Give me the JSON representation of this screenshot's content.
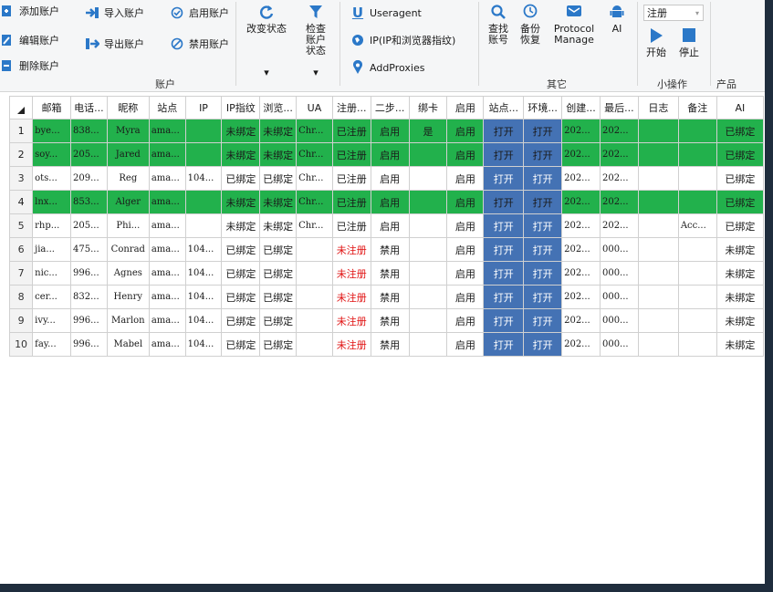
{
  "ribbon": {
    "account_group": {
      "add_account": "添加账户",
      "edit_account": "编辑账户",
      "delete_account": "删除账户",
      "import_account": "导入账户",
      "export_account": "导出账户",
      "enable_account": "启用账户",
      "disable_account": "禁用账户",
      "group_label": "账户"
    },
    "change_status": "改变状态",
    "check_status": "检查账户状态",
    "useragent": "Useragent",
    "ip_fingerprint": "IP(IP和浏览器指纹)",
    "add_proxies": "AddProxies",
    "find_account": "查找账号",
    "backup_restore": "备份恢复",
    "protocol_manage": "Protocol Manage",
    "ai": "AI",
    "other_label": "其它",
    "register_combo": "注册",
    "start": "开始",
    "stop": "停止",
    "small_ops_label": "小操作",
    "product_label": "产品"
  },
  "table": {
    "headers": [
      "",
      "邮箱",
      "电话...",
      "昵称",
      "站点",
      "IP",
      "IP指纹",
      "浏览...",
      "UA",
      "注册...",
      "二步...",
      "绑卡",
      "启用",
      "站点...",
      "环境...",
      "创建...",
      "最后...",
      "日志",
      "备注",
      "AI"
    ],
    "rows": [
      {
        "n": "1",
        "email": "bye...",
        "phone": "838...",
        "nick": "Myra",
        "site": "ama...",
        "ip": "",
        "ipfp": "未绑定",
        "browser": "未绑定",
        "ua": "Chr...",
        "reg": "已注册",
        "twostep": "启用",
        "card": "是",
        "enabled": "启用",
        "siteopen": "打开",
        "env": "打开",
        "created": "202...",
        "last": "202...",
        "log": "",
        "note": "",
        "ai": "已绑定",
        "green": true
      },
      {
        "n": "2",
        "email": "soy...",
        "phone": "205...",
        "nick": "Jared",
        "site": "ama...",
        "ip": "",
        "ipfp": "未绑定",
        "browser": "未绑定",
        "ua": "Chr...",
        "reg": "已注册",
        "twostep": "启用",
        "card": "",
        "enabled": "启用",
        "siteopen": "打开",
        "env": "打开",
        "created": "202...",
        "last": "202...",
        "log": "",
        "note": "",
        "ai": "已绑定",
        "green": true
      },
      {
        "n": "3",
        "email": "ots...",
        "phone": "209...",
        "nick": "Reg",
        "site": "ama...",
        "ip": "104...",
        "ipfp": "已绑定",
        "browser": "已绑定",
        "ua": "Chr...",
        "reg": "已注册",
        "twostep": "启用",
        "card": "",
        "enabled": "启用",
        "siteopen": "打开",
        "env": "打开",
        "created": "202...",
        "last": "202...",
        "log": "",
        "note": "",
        "ai": "已绑定",
        "green": false
      },
      {
        "n": "4",
        "email": "lnx...",
        "phone": "853...",
        "nick": "Alger",
        "site": "ama...",
        "ip": "",
        "ipfp": "未绑定",
        "browser": "未绑定",
        "ua": "Chr...",
        "reg": "已注册",
        "twostep": "启用",
        "card": "",
        "enabled": "启用",
        "siteopen": "打开",
        "env": "打开",
        "created": "202...",
        "last": "202...",
        "log": "",
        "note": "",
        "ai": "已绑定",
        "green": true
      },
      {
        "n": "5",
        "email": "rhp...",
        "phone": "205...",
        "nick": "Phi...",
        "site": "ama...",
        "ip": "",
        "ipfp": "未绑定",
        "browser": "未绑定",
        "ua": "Chr...",
        "reg": "已注册",
        "twostep": "启用",
        "card": "",
        "enabled": "启用",
        "siteopen": "打开",
        "env": "打开",
        "created": "202...",
        "last": "202...",
        "log": "",
        "note": "Acc...",
        "ai": "已绑定",
        "green": false
      },
      {
        "n": "6",
        "email": "jia...",
        "phone": "475...",
        "nick": "Conrad",
        "site": "ama...",
        "ip": "104...",
        "ipfp": "已绑定",
        "browser": "已绑定",
        "ua": "",
        "reg": "未注册",
        "twostep": "禁用",
        "card": "",
        "enabled": "启用",
        "siteopen": "打开",
        "env": "打开",
        "created": "202...",
        "last": "000...",
        "log": "",
        "note": "",
        "ai": "未绑定",
        "green": false,
        "unreg": true
      },
      {
        "n": "7",
        "email": "nic...",
        "phone": "996...",
        "nick": "Agnes",
        "site": "ama...",
        "ip": "104...",
        "ipfp": "已绑定",
        "browser": "已绑定",
        "ua": "",
        "reg": "未注册",
        "twostep": "禁用",
        "card": "",
        "enabled": "启用",
        "siteopen": "打开",
        "env": "打开",
        "created": "202...",
        "last": "000...",
        "log": "",
        "note": "",
        "ai": "未绑定",
        "green": false,
        "unreg": true
      },
      {
        "n": "8",
        "email": "cer...",
        "phone": "832...",
        "nick": "Henry",
        "site": "ama...",
        "ip": "104...",
        "ipfp": "已绑定",
        "browser": "已绑定",
        "ua": "",
        "reg": "未注册",
        "twostep": "禁用",
        "card": "",
        "enabled": "启用",
        "siteopen": "打开",
        "env": "打开",
        "created": "202...",
        "last": "000...",
        "log": "",
        "note": "",
        "ai": "未绑定",
        "green": false,
        "unreg": true
      },
      {
        "n": "9",
        "email": "ivy...",
        "phone": "996...",
        "nick": "Marlon",
        "site": "ama...",
        "ip": "104...",
        "ipfp": "已绑定",
        "browser": "已绑定",
        "ua": "",
        "reg": "未注册",
        "twostep": "禁用",
        "card": "",
        "enabled": "启用",
        "siteopen": "打开",
        "env": "打开",
        "created": "202...",
        "last": "000...",
        "log": "",
        "note": "",
        "ai": "未绑定",
        "green": false,
        "unreg": true
      },
      {
        "n": "10",
        "email": "fay...",
        "phone": "996...",
        "nick": "Mabel",
        "site": "ama...",
        "ip": "104...",
        "ipfp": "已绑定",
        "browser": "已绑定",
        "ua": "",
        "reg": "未注册",
        "twostep": "禁用",
        "card": "",
        "enabled": "启用",
        "siteopen": "打开",
        "env": "打开",
        "created": "202...",
        "last": "000...",
        "log": "",
        "note": "",
        "ai": "未绑定",
        "green": false,
        "unreg": true
      }
    ]
  },
  "colors": {
    "green_row": "#22b14c",
    "open_button": "#4472b4",
    "unregistered_text": "#e01010",
    "accent_blue": "#2b78c8"
  }
}
